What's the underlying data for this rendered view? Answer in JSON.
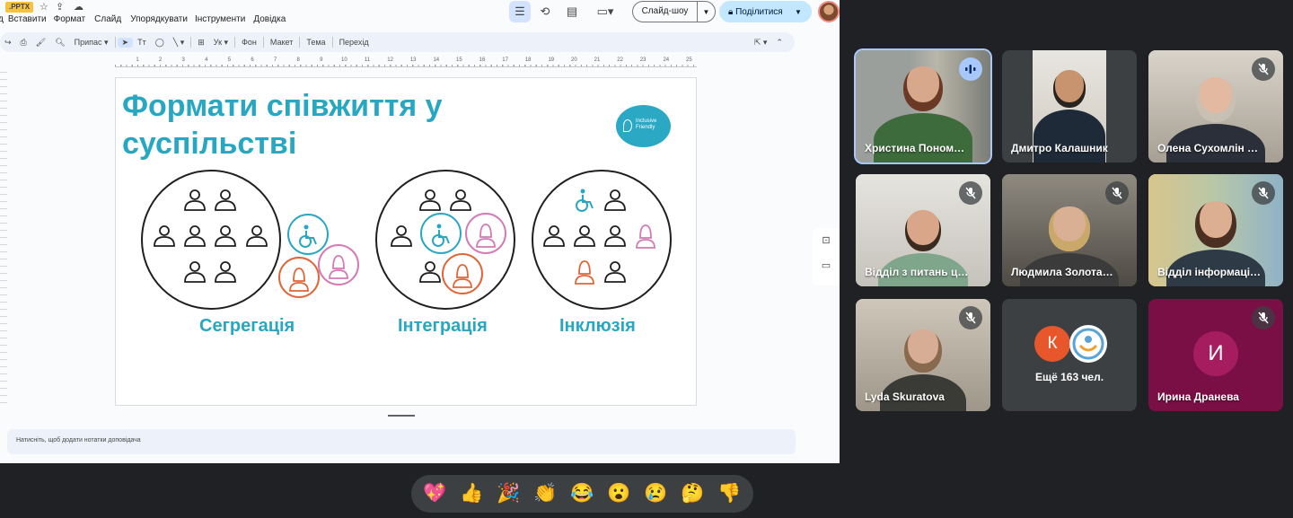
{
  "slides_app": {
    "file_badge": ".PPTX",
    "menu": [
      "д",
      "Вставити",
      "Формат",
      "Слайд",
      "Упорядкувати",
      "Інструменти",
      "Довідка"
    ],
    "slideshow_label": "Слайд-шоу",
    "share_label": "Поділитися",
    "toolbar": {
      "zoom_label": "Припас",
      "text_tool": "Tт",
      "background": "Фон",
      "layout": "Макет",
      "theme": "Тема",
      "transition": "Перехід"
    },
    "ruler_labels": [
      "1",
      "2",
      "3",
      "4",
      "5",
      "6",
      "7",
      "8",
      "9",
      "10",
      "11",
      "12",
      "13",
      "14",
      "15",
      "16",
      "17",
      "18",
      "19",
      "20",
      "21",
      "22",
      "23",
      "24",
      "25"
    ],
    "notes_placeholder": "Натисніть, щоб додати нотатки доповідача"
  },
  "slide": {
    "title_line1": "Формати співжиття у",
    "title_line2": "суспільстві",
    "logo_text": "Inclusive Friendly",
    "formats": [
      "Сегрегація",
      "Інтеграція",
      "Інклюзія"
    ],
    "colors": {
      "teal": "#28a7c2",
      "orange": "#e0663a",
      "pink": "#d47ab4",
      "ink": "#1f1f1f"
    }
  },
  "meeting": {
    "participants": [
      {
        "name": "Христина Поном…",
        "speaking": true
      },
      {
        "name": "Дмитро Калашник",
        "muted": false
      },
      {
        "name": "Олена Сухомлін …",
        "muted": true
      },
      {
        "name": "Відділ з питань ц…",
        "muted": true
      },
      {
        "name": "Людмила Золота…",
        "muted": true
      },
      {
        "name": "Відділ інформаці…",
        "muted": true
      },
      {
        "name": "Lyda Skuratova",
        "muted": true
      },
      {
        "name": "Ещё 163 чел.",
        "initial": "К"
      },
      {
        "name": "Ирина Дранева",
        "initial": "И",
        "muted": true
      }
    ]
  },
  "reactions": [
    "💖",
    "👍",
    "🎉",
    "👏",
    "😂",
    "😮",
    "😢",
    "🤔",
    "👎"
  ]
}
